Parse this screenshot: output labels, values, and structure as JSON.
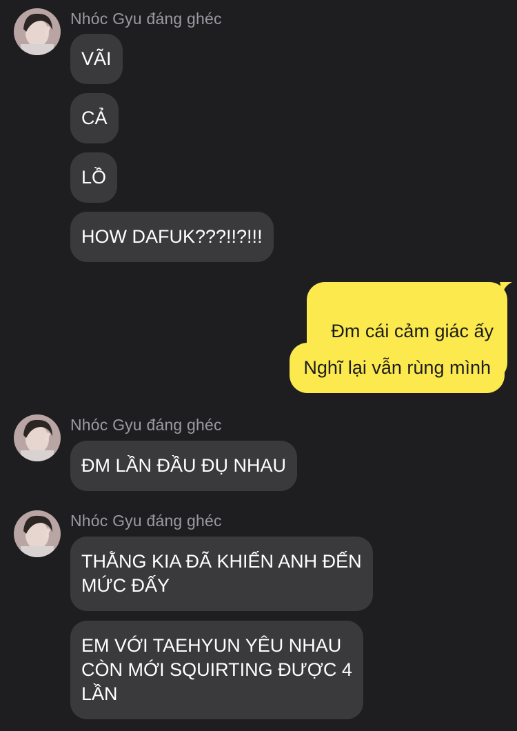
{
  "colors": {
    "background": "#1e1e20",
    "incoming_bubble": "#3a3a3d",
    "outgoing_bubble": "#fbe94d",
    "sender_text": "#9a9aa0"
  },
  "groups": [
    {
      "sender": "Nhóc Gyu đáng ghéc",
      "avatar_icon": "profile-photo",
      "messages": [
        "VÃI",
        "CẢ",
        "LỒ",
        "HOW DAFUK???!!?!!!"
      ]
    },
    {
      "outgoing": true,
      "messages": [
        "Đm cái cảm giác ấy",
        "Nghĩ lại vẫn rùng mình"
      ]
    },
    {
      "sender": "Nhóc Gyu đáng ghéc",
      "avatar_icon": "profile-photo",
      "messages": [
        "ĐM LẦN ĐẦU ĐỤ NHAU"
      ]
    },
    {
      "sender": "Nhóc Gyu đáng ghéc",
      "avatar_icon": "profile-photo",
      "messages": [
        "THẰNG KIA ĐÃ KHIẾN ANH ĐẾN\nMỨC ĐẤY",
        "EM VỚI TAEHYUN YÊU NHAU\nCÒN MỚI SQUIRTING ĐƯỢC 4\nLẦN"
      ]
    }
  ]
}
